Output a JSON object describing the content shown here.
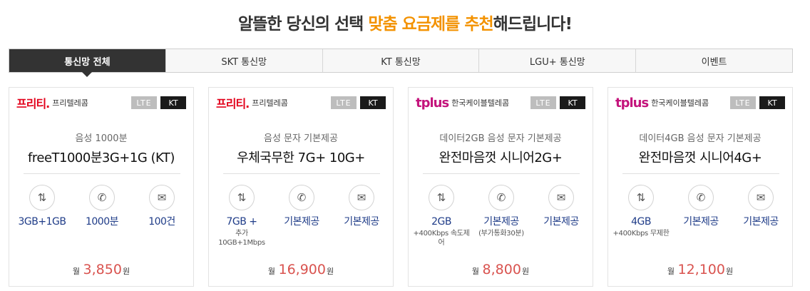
{
  "headline": {
    "part1": "알뜰한 당신의 선택 ",
    "highlight": "맞춤 요금제를 추천",
    "part2": "해드립니다!"
  },
  "tabs": [
    "통신망 전체",
    "SKT 통신망",
    "KT 통신망",
    "LGU+ 통신망",
    "이벤트"
  ],
  "colors": {
    "accent": "#f39200",
    "price": "#d9534f",
    "featureText": "#1f3c88",
    "activeTab": "#333333"
  },
  "cards": [
    {
      "logo": "프리티.",
      "company": "프리텔레콤",
      "network": "LTE",
      "carrier": "KT",
      "desc": "음성 1000분",
      "name": "freeT1000분3G+1G (KT)",
      "features": [
        {
          "icon": "data-arrows-icon",
          "value": "3GB+1GB",
          "sub": ""
        },
        {
          "icon": "phone-icon",
          "value": "1000분",
          "sub": ""
        },
        {
          "icon": "mail-icon",
          "value": "100건",
          "sub": ""
        }
      ],
      "price": {
        "prefix": "월",
        "amount": "3,850",
        "unit": "원"
      }
    },
    {
      "logo": "프리티.",
      "company": "프리텔레콤",
      "network": "LTE",
      "carrier": "KT",
      "desc": "음성 문자 기본제공",
      "name": "우체국무한 7G+ 10G+",
      "features": [
        {
          "icon": "data-arrows-icon",
          "value": "7GB +",
          "sub": "추가10GB+1Mbps"
        },
        {
          "icon": "phone-icon",
          "value": "기본제공",
          "sub": ""
        },
        {
          "icon": "mail-icon",
          "value": "기본제공",
          "sub": ""
        }
      ],
      "price": {
        "prefix": "월",
        "amount": "16,900",
        "unit": "원"
      }
    },
    {
      "logo": "tplus",
      "company": "한국케이블텔레콤",
      "network": "LTE",
      "carrier": "KT",
      "desc": "데이터2GB 음성 문자 기본제공",
      "name": "완전마음껏 시니어2G+",
      "features": [
        {
          "icon": "data-arrows-icon",
          "value": "2GB",
          "sub": "+400Kbps 속도제어"
        },
        {
          "icon": "phone-icon",
          "value": "기본제공",
          "sub": "(부가통화30분)"
        },
        {
          "icon": "mail-icon",
          "value": "기본제공",
          "sub": ""
        }
      ],
      "price": {
        "prefix": "월",
        "amount": "8,800",
        "unit": "원"
      }
    },
    {
      "logo": "tplus",
      "company": "한국케이블텔레콤",
      "network": "LTE",
      "carrier": "KT",
      "desc": "데이터4GB 음성 문자 기본제공",
      "name": "완전마음껏 시니어4G+",
      "features": [
        {
          "icon": "data-arrows-icon",
          "value": "4GB",
          "sub": "+400Kbps 무제한"
        },
        {
          "icon": "phone-icon",
          "value": "기본제공",
          "sub": ""
        },
        {
          "icon": "mail-icon",
          "value": "기본제공",
          "sub": ""
        }
      ],
      "price": {
        "prefix": "월",
        "amount": "12,100",
        "unit": "원"
      }
    }
  ]
}
